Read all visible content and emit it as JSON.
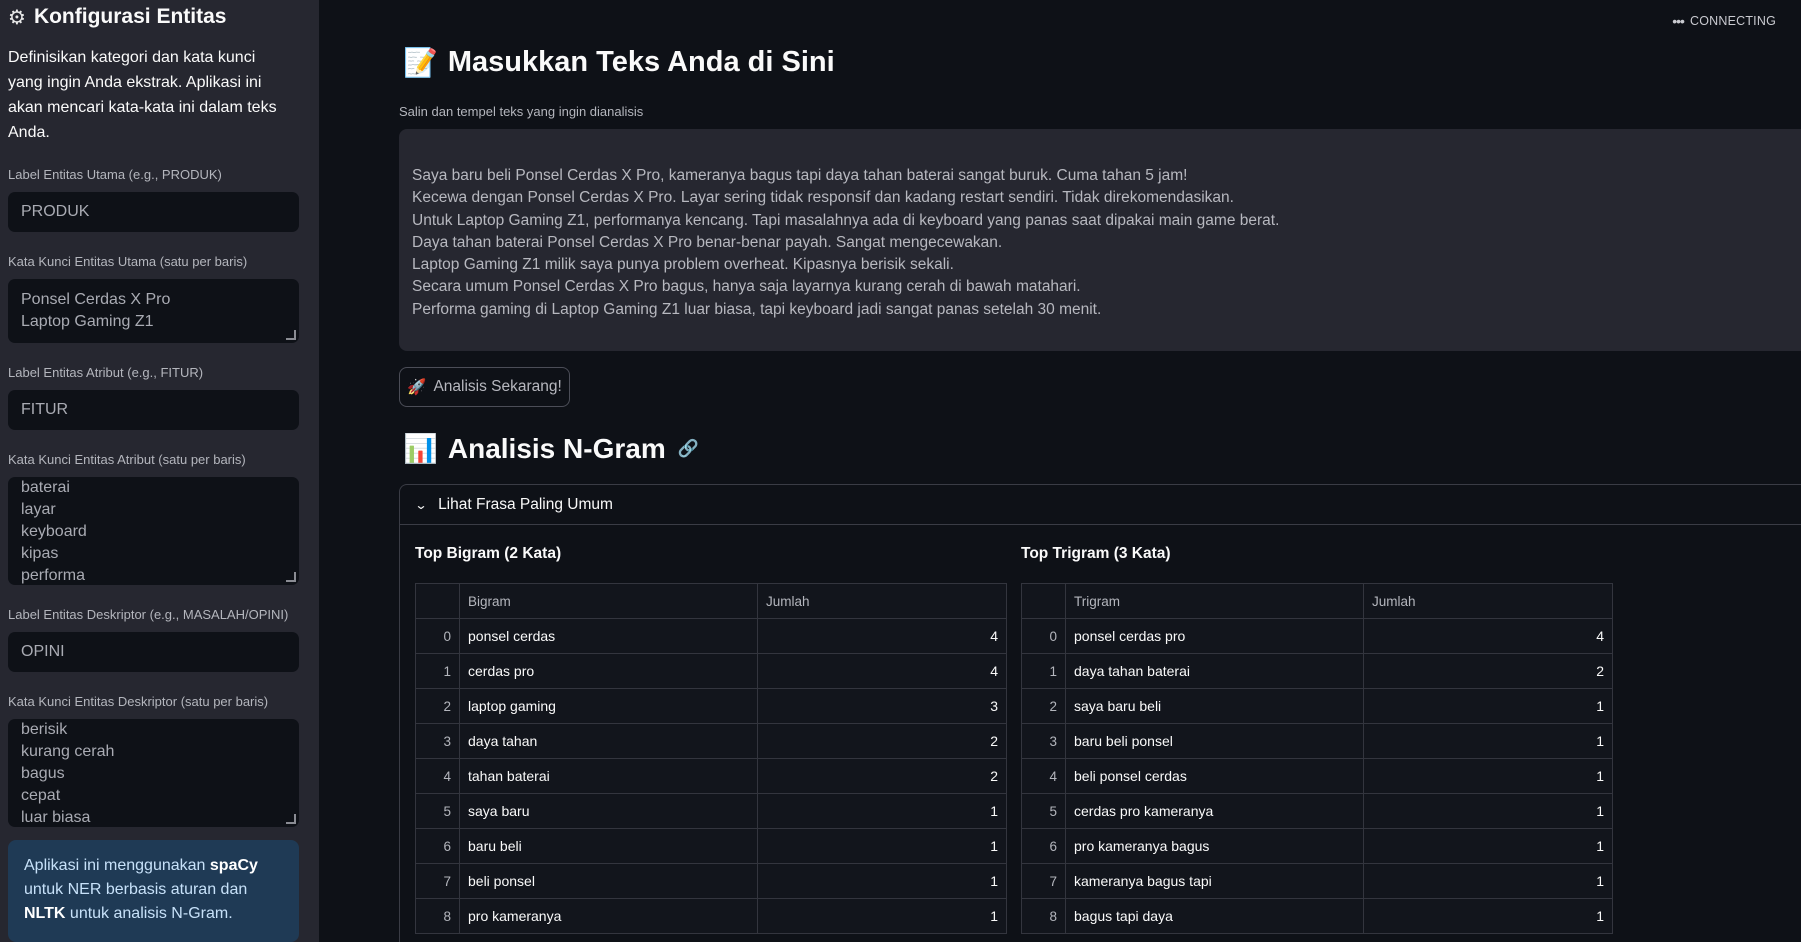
{
  "sidebar": {
    "title": "Konfigurasi Entitas",
    "gear_icon": "gear-icon",
    "description": "Definisikan kategori dan kata kunci yang ingin Anda ekstrak. Aplikasi ini akan mencari kata-kata ini dalam teks Anda.",
    "main_label_caption": "Label Entitas Utama (e.g., PRODUK)",
    "main_label_value": "PRODUK",
    "main_keywords_caption": "Kata Kunci Entitas Utama (satu per baris)",
    "main_keywords": [
      "Ponsel Cerdas X Pro",
      "Laptop Gaming Z1"
    ],
    "attr_label_caption": "Label Entitas Atribut (e.g., FITUR)",
    "attr_label_value": "FITUR",
    "attr_keywords_caption": "Kata Kunci Entitas Atribut (satu per baris)",
    "attr_keywords": [
      "baterai",
      "layar",
      "keyboard",
      "kipas",
      "performa"
    ],
    "desc_label_caption": "Label Entitas Deskriptor (e.g., MASALAH/OPINI)",
    "desc_label_value": "OPINI",
    "desc_keywords_caption": "Kata Kunci Entitas Deskriptor (satu per baris)",
    "desc_keywords": [
      "berisik",
      "kurang cerah",
      "bagus",
      "cepat",
      "luar biasa"
    ],
    "info_prefix": "Aplikasi ini menggunakan ",
    "info_spacy": "spaCy",
    "info_mid": " untuk NER berbasis aturan dan ",
    "info_nltk": "NLTK",
    "info_suffix": " untuk analisis N-Gram."
  },
  "status": {
    "label": "CONNECTING"
  },
  "main": {
    "title_emoji": "📝",
    "title": "Masukkan Teks Anda di Sini",
    "input_label": "Salin dan tempel teks yang ingin dianalisis",
    "input_lines": [
      "Saya baru beli Ponsel Cerdas X Pro, kameranya bagus tapi daya tahan baterai sangat buruk. Cuma tahan 5 jam!",
      "Kecewa dengan Ponsel Cerdas X Pro. Layar sering tidak responsif dan kadang restart sendiri. Tidak direkomendasikan.",
      "Untuk Laptop Gaming Z1, performanya kencang. Tapi masalahnya ada di keyboard yang panas saat dipakai main game berat.",
      "Daya tahan baterai Ponsel Cerdas X Pro benar-benar payah. Sangat mengecewakan.",
      "Laptop Gaming Z1 milik saya punya problem overheat. Kipasnya berisik sekali.",
      "Secara umum Ponsel Cerdas X Pro bagus, hanya saja layarnya kurang cerah di bawah matahari.",
      "Performa gaming di Laptop Gaming Z1 luar biasa, tapi keyboard jadi sangat panas setelah 30 menit."
    ],
    "button_emoji": "🚀",
    "button_label": "Analisis Sekarang!",
    "section_emoji": "📊",
    "section_title": "Analisis N-Gram",
    "expander_label": "Lihat Frasa Paling Umum",
    "bigram_title": "Top Bigram (2 Kata)",
    "trigram_title": "Top Trigram (3 Kata)",
    "bigram_headers": [
      "",
      "Bigram",
      "Jumlah"
    ],
    "trigram_headers": [
      "",
      "Trigram",
      "Jumlah"
    ],
    "bigrams": [
      {
        "idx": "0",
        "phrase": "ponsel cerdas",
        "count": "4"
      },
      {
        "idx": "1",
        "phrase": "cerdas pro",
        "count": "4"
      },
      {
        "idx": "2",
        "phrase": "laptop gaming",
        "count": "3"
      },
      {
        "idx": "3",
        "phrase": "daya tahan",
        "count": "2"
      },
      {
        "idx": "4",
        "phrase": "tahan baterai",
        "count": "2"
      },
      {
        "idx": "5",
        "phrase": "saya baru",
        "count": "1"
      },
      {
        "idx": "6",
        "phrase": "baru beli",
        "count": "1"
      },
      {
        "idx": "7",
        "phrase": "beli ponsel",
        "count": "1"
      },
      {
        "idx": "8",
        "phrase": "pro kameranya",
        "count": "1"
      }
    ],
    "trigrams": [
      {
        "idx": "0",
        "phrase": "ponsel cerdas pro",
        "count": "4"
      },
      {
        "idx": "1",
        "phrase": "daya tahan baterai",
        "count": "2"
      },
      {
        "idx": "2",
        "phrase": "saya baru beli",
        "count": "1"
      },
      {
        "idx": "3",
        "phrase": "baru beli ponsel",
        "count": "1"
      },
      {
        "idx": "4",
        "phrase": "beli ponsel cerdas",
        "count": "1"
      },
      {
        "idx": "5",
        "phrase": "cerdas pro kameranya",
        "count": "1"
      },
      {
        "idx": "6",
        "phrase": "pro kameranya bagus",
        "count": "1"
      },
      {
        "idx": "7",
        "phrase": "kameranya bagus tapi",
        "count": "1"
      },
      {
        "idx": "8",
        "phrase": "bagus tapi daya",
        "count": "1"
      }
    ]
  },
  "colors": {
    "background": "#0e1117",
    "sidebar": "#262730",
    "info_box": "#1f3a55",
    "text": "#fafafa"
  }
}
